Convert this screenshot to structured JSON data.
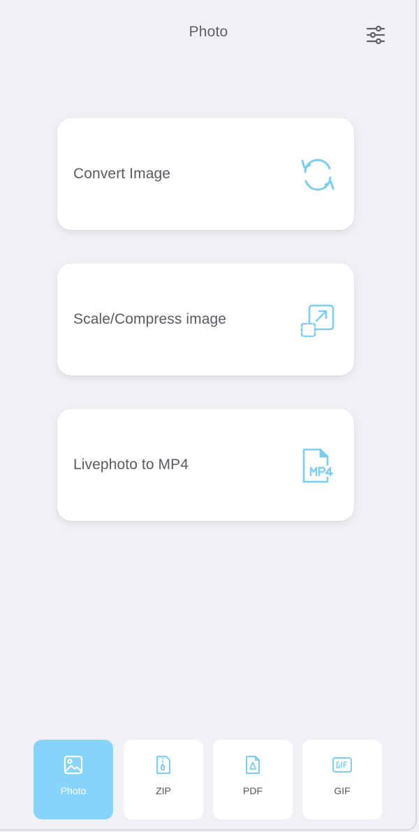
{
  "header": {
    "title": "Photo",
    "settings_icon": "sliders-icon"
  },
  "colors": {
    "background": "#f0f1f6",
    "accent": "#87d4fa",
    "icon_stroke": "#7dcdf2",
    "text": "#5a5b61"
  },
  "cards": [
    {
      "label": "Convert Image",
      "icon": "convert-icon"
    },
    {
      "label": "Scale/Compress image",
      "icon": "resize-icon"
    },
    {
      "label": "Livephoto to MP4",
      "icon": "mp4-file-icon"
    }
  ],
  "tabs": [
    {
      "label": "Photo",
      "icon": "image-icon",
      "active": true
    },
    {
      "label": "ZIP",
      "icon": "zip-file-icon",
      "active": false
    },
    {
      "label": "PDF",
      "icon": "pdf-file-icon",
      "active": false
    },
    {
      "label": "GIF",
      "icon": "gif-icon",
      "active": false
    }
  ]
}
